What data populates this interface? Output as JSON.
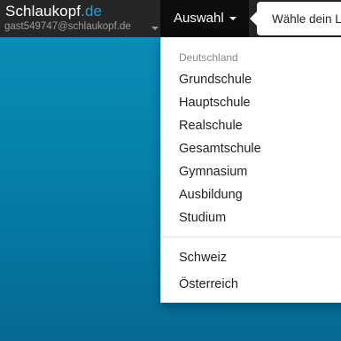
{
  "navbar": {
    "brand_name": "Schlaukopf",
    "brand_tld": ".de",
    "user_email": "gast549747@schlaukopf.de",
    "menu_label": "Auswahl"
  },
  "tooltip": {
    "text": "Wähle dein L"
  },
  "dropdown": {
    "section_header": "Deutschland",
    "items": [
      "Grundschule",
      "Hauptschule",
      "Realschule",
      "Gesamtschule",
      "Gymnasium",
      "Ausbildung",
      "Studium"
    ],
    "other_countries": [
      "Schweiz",
      "Österreich"
    ]
  },
  "colors": {
    "navbar_bg": "#262626",
    "active_menu_bg": "#0c0c0c",
    "brand_accent": "#2a9fd6",
    "background": "#0683ad"
  }
}
